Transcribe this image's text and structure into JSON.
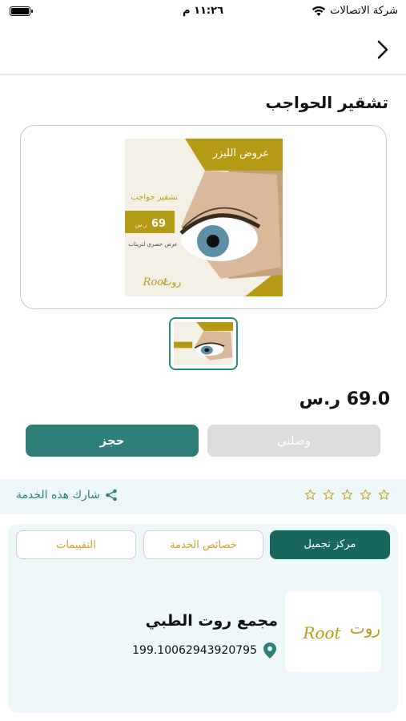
{
  "status_bar": {
    "carrier": "شركة الاتصالات",
    "time": "١١:٢٦ م"
  },
  "page": {
    "title": "تشقير الحواجب",
    "price": "69.0 ر.س"
  },
  "promo_image": {
    "headline": "عروض الليزر",
    "service": "تشقير حواجب",
    "price_number": "69",
    "price_unit": "ر.س",
    "offer_text": "عرض حصري لتريتاب",
    "brand_arabic": "روت",
    "brand_latin": "Root",
    "colors": {
      "gold": "#b59a16",
      "cream": "#f4f0e6"
    }
  },
  "actions": {
    "book_label": "حجز",
    "arrived_label": "وصلني"
  },
  "share": {
    "label": "شارك هذه الخدمة",
    "rating_stars": 0,
    "max_stars": 5
  },
  "tabs": [
    {
      "label": "مركز تجميل",
      "active": true
    },
    {
      "label": "خصائص الخدمة",
      "active": false
    },
    {
      "label": "التقييمات",
      "active": false
    }
  ],
  "provider": {
    "name": "مجمع روت الطبي",
    "coordinates": "199.10062943920795",
    "logo_arabic": "روت",
    "logo_latin": "Root"
  },
  "colors": {
    "primary": "#2e7f78",
    "tab_active": "#17675f",
    "gold": "#c9a62e",
    "strip": "#eef8fb",
    "disabled": "#dcdcdc"
  }
}
